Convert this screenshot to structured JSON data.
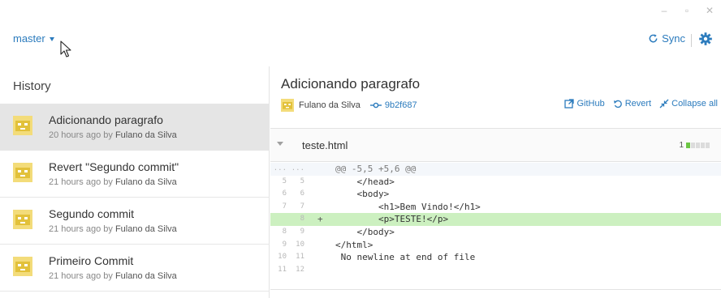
{
  "window": {
    "minimize_glyph": "–",
    "maximize_glyph": "▫",
    "close_glyph": "✕"
  },
  "toolbar": {
    "branch_label": "master",
    "sync_label": "Sync"
  },
  "history": {
    "title": "History",
    "commits": [
      {
        "title": "Adicionando paragrafo",
        "time": "20 hours ago by",
        "author": "Fulano da Silva",
        "selected": true
      },
      {
        "title": "Revert \"Segundo commit\"",
        "time": "21 hours ago by",
        "author": "Fulano da Silva",
        "selected": false
      },
      {
        "title": "Segundo commit",
        "time": "21 hours ago by",
        "author": "Fulano da Silva",
        "selected": false
      },
      {
        "title": "Primeiro Commit",
        "time": "21 hours ago by",
        "author": "Fulano da Silva",
        "selected": false
      }
    ]
  },
  "detail": {
    "title": "Adicionando paragrafo",
    "author": "Fulano da Silva",
    "sha": "9b2f687",
    "actions": {
      "github": "GitHub",
      "revert": "Revert",
      "collapse": "Collapse all"
    },
    "file": {
      "name": "teste.html",
      "additions": "1"
    },
    "diff": [
      {
        "type": "hunk",
        "ln1": "...",
        "ln2": "...",
        "sign": "",
        "code": "@@ -5,5 +5,6 @@"
      },
      {
        "type": "ctx",
        "ln1": "5",
        "ln2": "5",
        "sign": "",
        "code": "    </head>"
      },
      {
        "type": "ctx",
        "ln1": "6",
        "ln2": "6",
        "sign": "",
        "code": "    <body>"
      },
      {
        "type": "ctx",
        "ln1": "7",
        "ln2": "7",
        "sign": "",
        "code": "        <h1>Bem Vindo!</h1>"
      },
      {
        "type": "add",
        "ln1": "",
        "ln2": "8",
        "sign": "+",
        "code": "        <p>TESTE!</p>"
      },
      {
        "type": "ctx",
        "ln1": "8",
        "ln2": "9",
        "sign": "",
        "code": "    </body>"
      },
      {
        "type": "ctx",
        "ln1": "9",
        "ln2": "10",
        "sign": "",
        "code": "</html>"
      },
      {
        "type": "ctx",
        "ln1": "10",
        "ln2": "11",
        "sign": "",
        "code": " No newline at end of file"
      },
      {
        "type": "ctx",
        "ln1": "11",
        "ln2": "12",
        "sign": "",
        "code": ""
      }
    ]
  },
  "colors": {
    "accent": "#2b7bbd",
    "added_line": "#ccf0c0",
    "selected_row": "#e5e5e5",
    "avatar": "#e2c13a"
  }
}
